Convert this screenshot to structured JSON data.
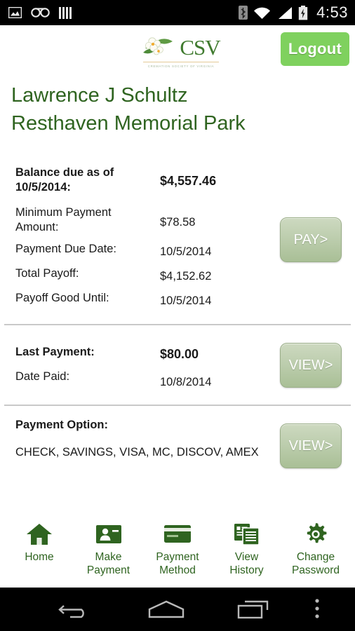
{
  "statusbar": {
    "icons_left": [
      "image-icon",
      "voicemail-icon",
      "bars-icon"
    ],
    "icons_right": [
      "bluetooth-icon",
      "wifi-icon",
      "signal-icon",
      "battery-charging-icon"
    ],
    "time": "4:53"
  },
  "header": {
    "logo_text": "CSV",
    "logo_tagline": "Cremation Society of Virginia",
    "logout_label": "Logout"
  },
  "account": {
    "name": "Lawrence J Schultz",
    "location": "Resthaven Memorial Park"
  },
  "balance_section": {
    "rows": [
      {
        "label": "Balance due as of 10/5/2014:",
        "value": "$4,557.46"
      },
      {
        "label": "Minimum Payment Amount:",
        "value": "$78.58"
      },
      {
        "label": "Payment Due Date:",
        "value": "10/5/2014"
      },
      {
        "label": "Total Payoff:",
        "value": "$4,152.62"
      },
      {
        "label": "Payoff Good Until:",
        "value": "10/5/2014"
      }
    ],
    "action_label": "PAY>"
  },
  "last_payment_section": {
    "rows": [
      {
        "label": "Last Payment:",
        "value": "$80.00"
      },
      {
        "label": "Date Paid:",
        "value": "10/8/2014"
      }
    ],
    "action_label": "VIEW>"
  },
  "payment_option_section": {
    "title": "Payment Option:",
    "options": "CHECK, SAVINGS, VISA, MC, DISCOV, AMEX",
    "action_label": "VIEW>"
  },
  "bottom_nav": [
    {
      "icon": "home-icon",
      "line1": "Home",
      "line2": ""
    },
    {
      "icon": "make-payment-icon",
      "line1": "Make",
      "line2": "Payment"
    },
    {
      "icon": "credit-card-icon",
      "line1": "Payment",
      "line2": "Method"
    },
    {
      "icon": "documents-icon",
      "line1": "View",
      "line2": "History"
    },
    {
      "icon": "gear-icon",
      "line1": "Change",
      "line2": "Password"
    }
  ],
  "android_nav": {
    "back": "back-icon",
    "home": "home-icon",
    "recents": "recents-icon",
    "menu": "overflow-menu-icon"
  },
  "colors": {
    "brand_green": "#2f6420",
    "logout_green": "#7fd15e",
    "sage_button": "#bccdad",
    "text": "#1a1a1a"
  }
}
